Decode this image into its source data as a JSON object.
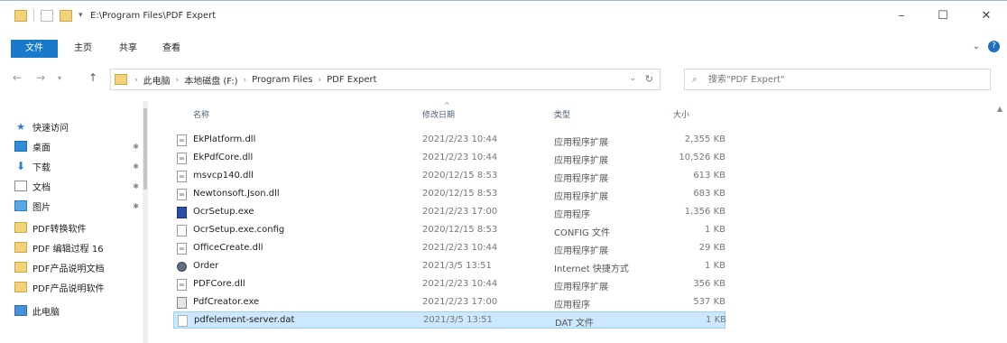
{
  "titlebar": {
    "path": "E:\\Program Files\\PDF Expert",
    "minimize": "–",
    "maximize": "☐",
    "close": "✕"
  },
  "ribbon": {
    "tabs": [
      "文件",
      "主页",
      "共享",
      "查看"
    ]
  },
  "addressbar": {
    "crumbs": [
      "此电脑",
      "本地磁盘 (F:)",
      "Program Files",
      "PDF Expert"
    ],
    "search_placeholder": "搜索\"PDF Expert\""
  },
  "navpane": {
    "items": [
      {
        "label": "快速访问",
        "icon": "star-icon"
      },
      {
        "label": "桌面",
        "icon": "desktop-icon"
      },
      {
        "label": "下载",
        "icon": "download-icon"
      },
      {
        "label": "文档",
        "icon": "document-icon"
      },
      {
        "label": "图片",
        "icon": "picture-icon"
      },
      {
        "label": "PDF转换软件",
        "icon": "folder-icon"
      },
      {
        "label": "PDF 编辑过程 16",
        "icon": "folder-icon"
      },
      {
        "label": "PDF产品说明文档",
        "icon": "folder-icon"
      },
      {
        "label": "PDF产品说明软件",
        "icon": "folder-icon"
      },
      {
        "label": "此电脑",
        "icon": "computer-icon"
      }
    ]
  },
  "table": {
    "columns": {
      "name": "名称",
      "date": "修改日期",
      "type": "类型",
      "size": "大小"
    },
    "sort_hint": "^",
    "rows": [
      {
        "name": "EkPlatform.dll",
        "date": "2021/2/23 10:44",
        "type": "应用程序扩展",
        "size": "2,355 KB",
        "icon": "dll-file-icon"
      },
      {
        "name": "EkPdfCore.dll",
        "date": "2021/2/23 10:44",
        "type": "应用程序扩展",
        "size": "10,526 KB",
        "icon": "dll-file-icon"
      },
      {
        "name": "msvcp140.dll",
        "date": "2020/12/15 8:53",
        "type": "应用程序扩展",
        "size": "613 KB",
        "icon": "dll-file-icon"
      },
      {
        "name": "Newtonsoft.Json.dll",
        "date": "2020/12/15 8:53",
        "type": "应用程序扩展",
        "size": "683 KB",
        "icon": "dll-file-icon"
      },
      {
        "name": "OcrSetup.exe",
        "date": "2021/2/23 17:00",
        "type": "应用程序",
        "size": "1,356 KB",
        "icon": "application-icon"
      },
      {
        "name": "OcrSetup.exe.config",
        "date": "2020/12/15 8:53",
        "type": "CONFIG 文件",
        "size": "1 KB",
        "icon": "config-file-icon"
      },
      {
        "name": "OfficeCreate.dll",
        "date": "2021/2/23 10:44",
        "type": "应用程序扩展",
        "size": "29 KB",
        "icon": "dll-file-icon"
      },
      {
        "name": "Order",
        "date": "2021/3/5 13:51",
        "type": "Internet 快捷方式",
        "size": "1 KB",
        "icon": "shortcut-gear-icon"
      },
      {
        "name": "PDFCore.dll",
        "date": "2021/2/23 10:44",
        "type": "应用程序扩展",
        "size": "356 KB",
        "icon": "dll-file-icon"
      },
      {
        "name": "PdfCreator.exe",
        "date": "2021/2/23 17:00",
        "type": "应用程序",
        "size": "537 KB",
        "icon": "exe-file-icon"
      },
      {
        "name": "pdfelement-server.dat",
        "date": "2021/3/5 13:51",
        "type": "DAT 文件",
        "size": "1 KB",
        "icon": "dat-file-icon",
        "selected": true
      }
    ]
  }
}
